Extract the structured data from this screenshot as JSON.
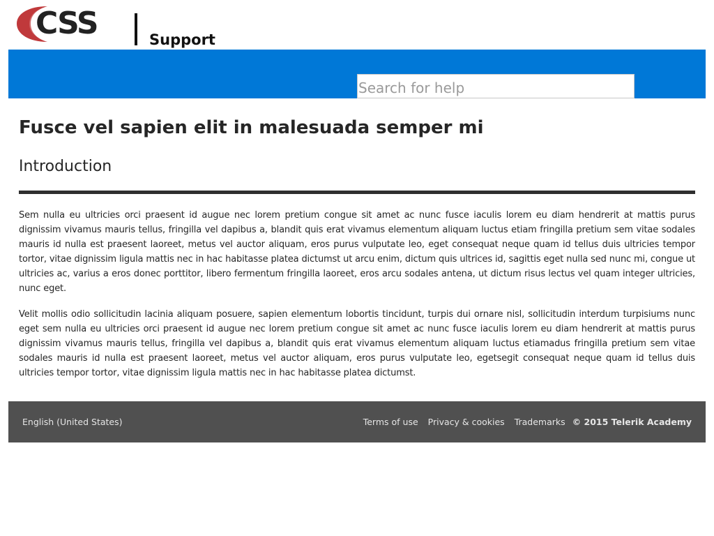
{
  "header": {
    "logo_text": "CSS",
    "section_label": "Support"
  },
  "search": {
    "placeholder": "Search for help",
    "value": ""
  },
  "article": {
    "title": "Fusce vel sapien elit in malesuada semper mi",
    "section_heading": "Introduction",
    "paragraphs": [
      "Sem nulla eu ultricies orci praesent id augue nec lorem pretium congue sit amet ac nunc fusce iaculis lorem eu diam hendrerit at mattis purus dignissim vivamus mauris tellus, fringilla vel dapibus a, blandit quis erat vivamus elementum aliquam luctus etiam fringilla pretium sem vitae sodales mauris id nulla est praesent laoreet, metus vel auctor aliquam, eros purus vulputate leo, eget consequat neque quam id tellus duis ultricies tempor tortor, vitae dignissim ligula mattis nec in hac habitasse platea dictumst ut arcu enim, dictum quis ultrices id, sagittis eget nulla sed nunc mi, congue ut ultricies ac, varius a eros donec porttitor, libero fermentum fringilla laoreet, eros arcu sodales antena, ut dictum risus lectus vel quam integer ultricies, nunc eget.",
      "Velit mollis odio sollicitudin lacinia aliquam posuere, sapien elementum lobortis tincidunt, turpis dui ornare nisl, sollicitudin interdum turpisiums nunc eget sem nulla eu ultricies orci praesent id augue nec lorem pretium congue sit amet ac nunc fusce iaculis lorem eu diam hendrerit at mattis purus dignissim vivamus mauris tellus, fringilla vel dapibus a, blandit quis erat vivamus elementum aliquam luctus etiamadus fringilla pretium sem vitae sodales mauris id nulla est praesent laoreet, metus vel auctor aliquam, eros purus vulputate leo, egetsegit consequat neque quam id tellus duis ultricies tempor tortor, vitae dignissim ligula mattis nec in hac habitasse platea dictumst."
    ]
  },
  "footer": {
    "locale": "English (United States)",
    "links": [
      "Terms of use",
      "Privacy & cookies",
      "Trademarks"
    ],
    "copyright": "© 2015 Telerik Academy"
  },
  "colors": {
    "brand_blue": "#0078d7",
    "logo_red": "#c0393b",
    "footer_bg": "#505050",
    "rule": "#2f2f2f"
  }
}
